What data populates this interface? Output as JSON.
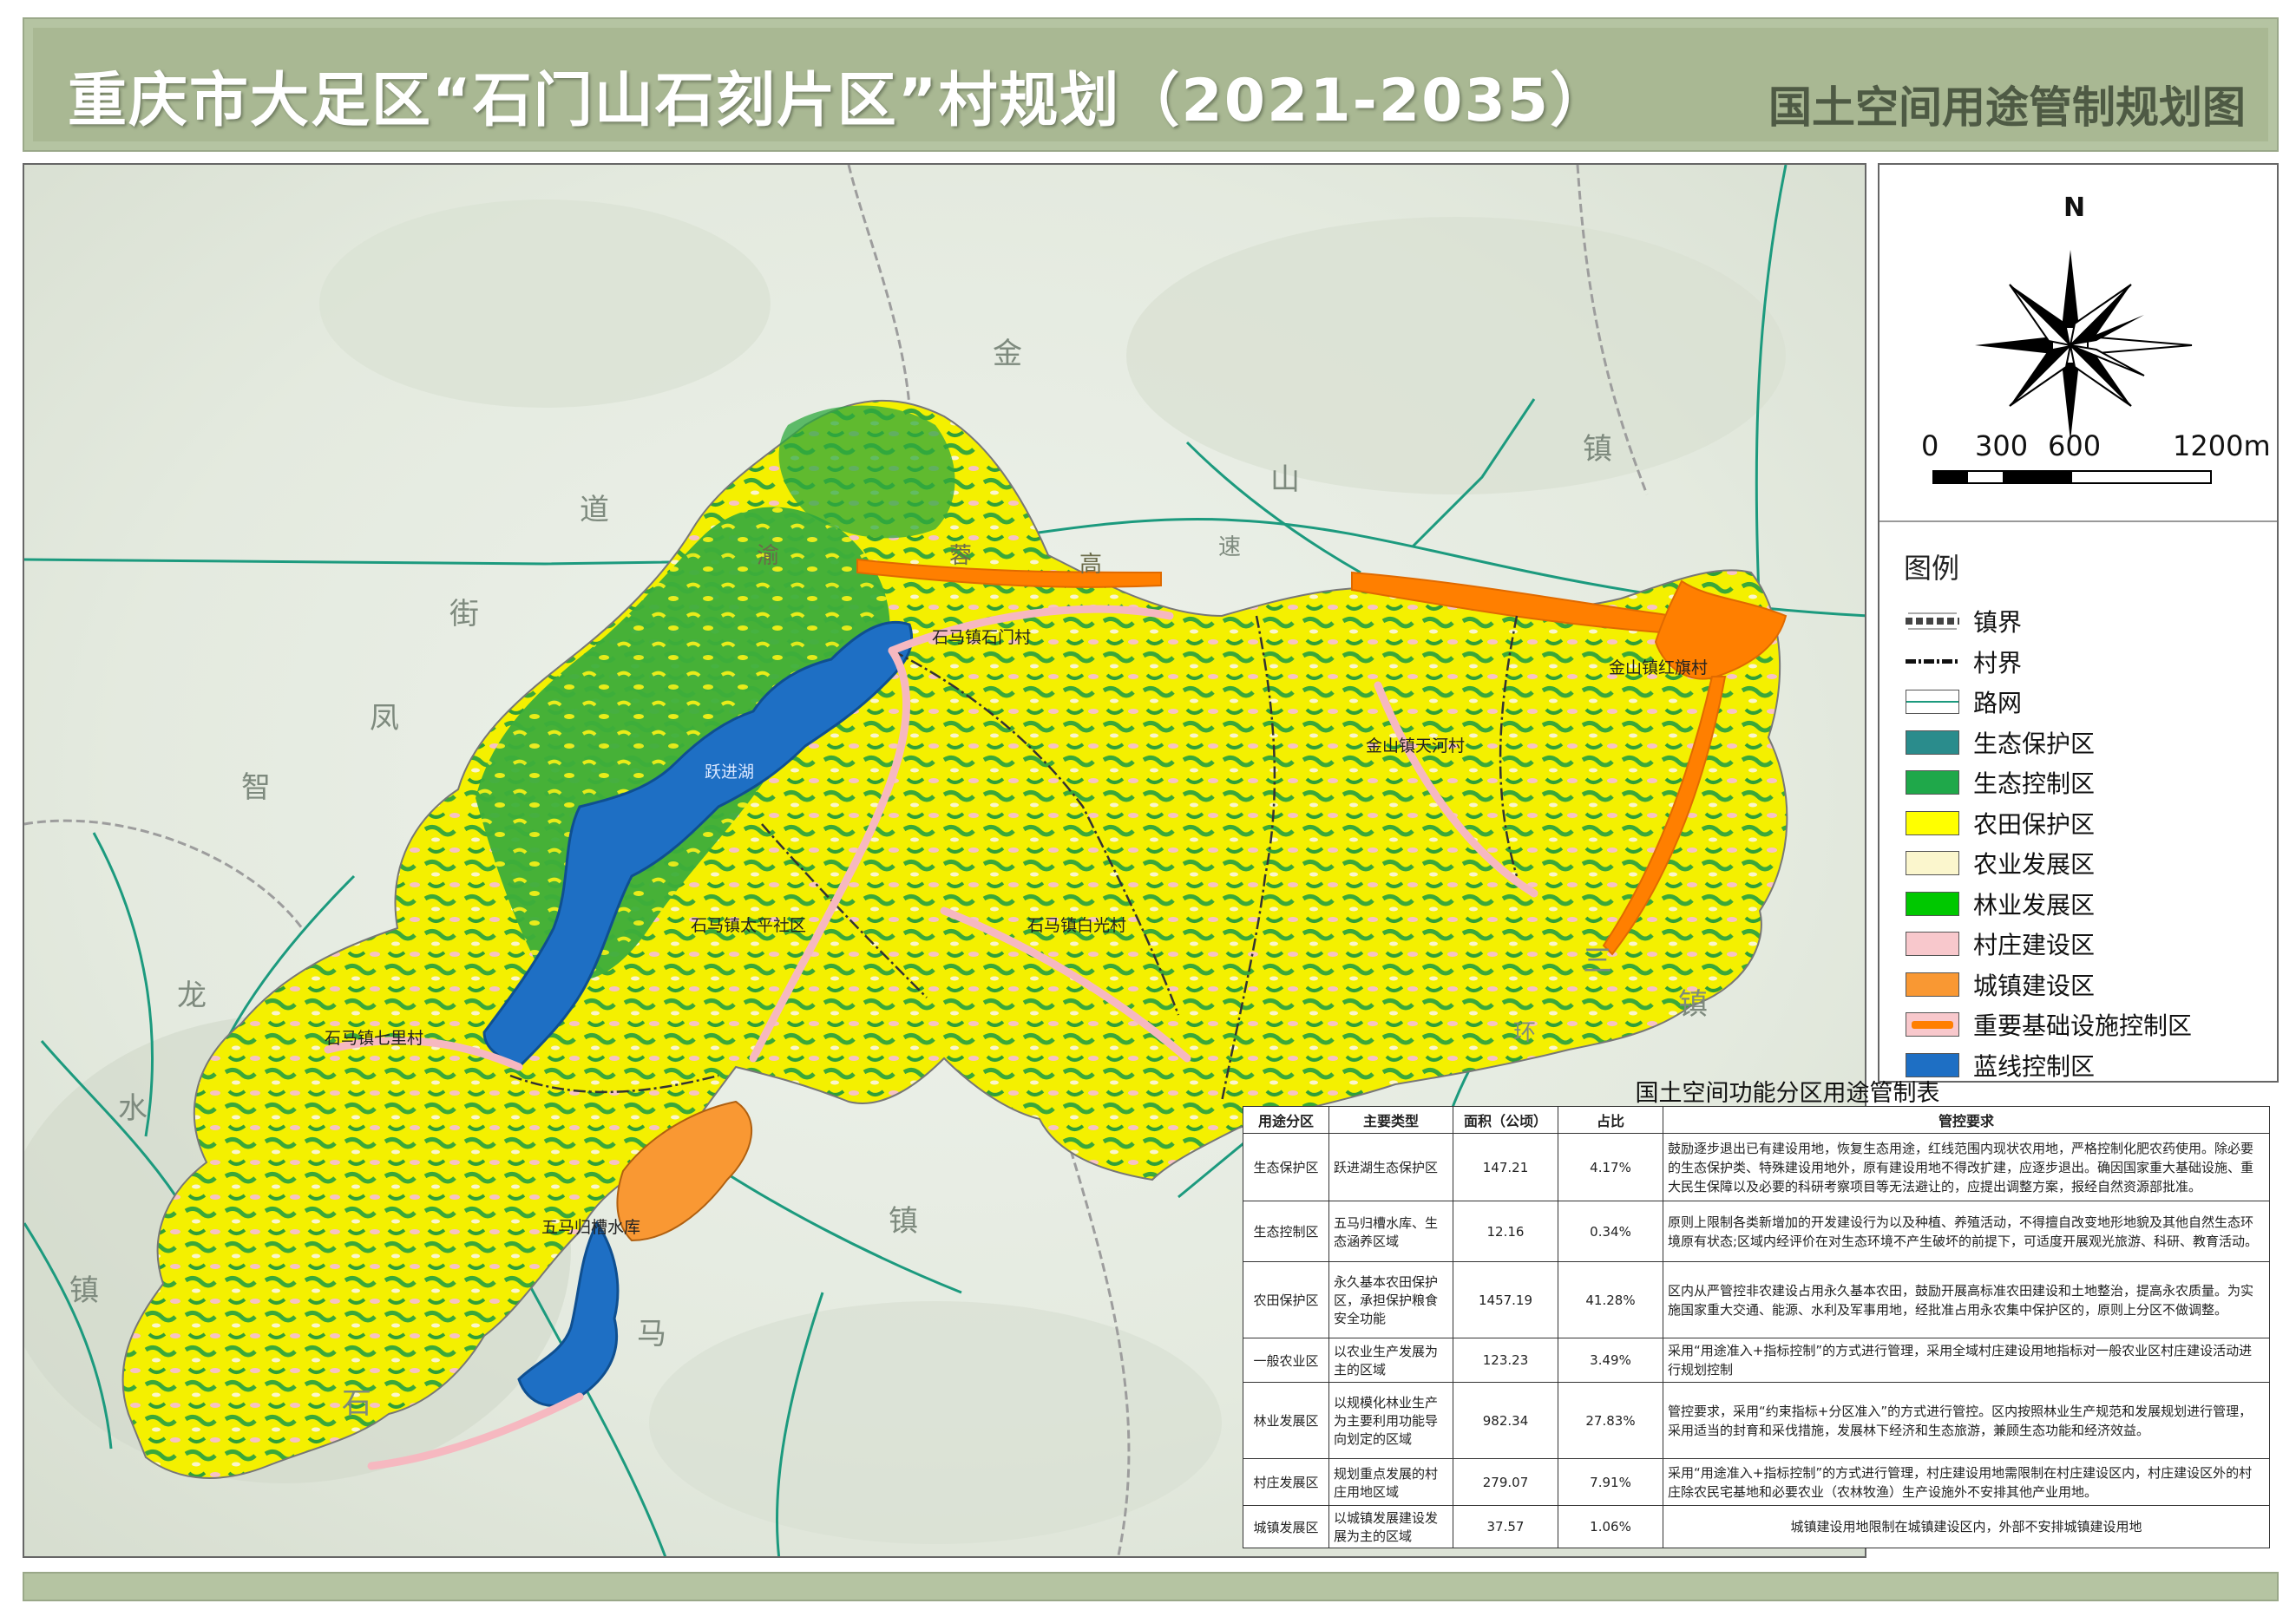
{
  "header": {
    "title": "重庆市大足区“石门山石刻片区”村规划（2021-2035）",
    "subtitle": "国土空间用途管制规划图"
  },
  "compass": {
    "north_label": "N"
  },
  "scale": {
    "labels": [
      "0",
      "300",
      "600",
      "1200m"
    ]
  },
  "legend": {
    "title": "图例",
    "items": [
      {
        "label": "镇界",
        "color": "#ffffff",
        "style": "town-line"
      },
      {
        "label": "村界",
        "color": "#ffffff",
        "style": "village-line"
      },
      {
        "label": "路网",
        "color": "#ffffff",
        "style": "road-line"
      },
      {
        "label": "生态保护区",
        "color": "#2a8c8c",
        "style": "fill"
      },
      {
        "label": "生态控制区",
        "color": "#1fa84a",
        "style": "fill"
      },
      {
        "label": "农田保护区",
        "color": "#ffff00",
        "style": "fill"
      },
      {
        "label": "农业发展区",
        "color": "#fbf6cd",
        "style": "fill"
      },
      {
        "label": "林业发展区",
        "color": "#00c800",
        "style": "fill"
      },
      {
        "label": "村庄建设区",
        "color": "#f8c8cc",
        "style": "fill"
      },
      {
        "label": "城镇建设区",
        "color": "#f99833",
        "style": "fill"
      },
      {
        "label": "重要基础设施控制区",
        "color": "#ff7f00",
        "style": "infra"
      },
      {
        "label": "蓝线控制区",
        "color": "#1e6fc4",
        "style": "fill"
      }
    ]
  },
  "map": {
    "place_labels": [
      "金",
      "山",
      "镇",
      "道",
      "街",
      "凤",
      "智",
      "龙",
      "水",
      "镇",
      "石",
      "马",
      "镇",
      "三",
      "镇",
      "环",
      "速",
      "高",
      "蓉",
      "渝"
    ],
    "village_labels": [
      "石马镇石门村",
      "金山镇红旗村",
      "金山镇天河村",
      "跃进湖",
      "石马镇太平社区",
      "石马镇白光村",
      "石马镇七里村",
      "五马归槽水库"
    ]
  },
  "table": {
    "title": "国土空间功能分区用途管制表",
    "headers": [
      "用途分区",
      "主要类型",
      "面积（公顷）",
      "占比",
      "管控要求"
    ],
    "rows": [
      [
        "生态保护区",
        "跃进湖生态保护区",
        "147.21",
        "4.17%",
        "鼓励逐步退出已有建设用地，恢复生态用途，红线范围内现状农用地，严格控制化肥农药使用。除必要的生态保护类、特殊建设用地外，原有建设用地不得改扩建，应逐步退出。确因国家重大基础设施、重大民生保障以及必要的科研考察项目等无法避让的，应提出调整方案，报经自然资源部批准。"
      ],
      [
        "生态控制区",
        "五马归槽水库、生态涵养区域",
        "12.16",
        "0.34%",
        "原则上限制各类新增加的开发建设行为以及种植、养殖活动，不得擅自改变地形地貌及其他自然生态环境原有状态;区域内经评价在对生态环境不产生破坏的前提下，可适度开展观光旅游、科研、教育活动。"
      ],
      [
        "农田保护区",
        "永久基本农田保护区，承担保护粮食安全功能",
        "1457.19",
        "41.28%",
        "区内从严管控非农建设占用永久基本农田，鼓励开展高标准农田建设和土地整治，提高永农质量。为实施国家重大交通、能源、水利及军事用地，经批准占用永农集中保护区的，原则上分区不做调整。"
      ],
      [
        "一般农业区",
        "以农业生产发展为主的区域",
        "123.23",
        "3.49%",
        "采用“用途准入+指标控制”的方式进行管理，采用全域村庄建设用地指标对一般农业区村庄建设活动进行规划控制"
      ],
      [
        "林业发展区",
        "以规模化林业生产为主要利用功能导向划定的区域",
        "982.34",
        "27.83%",
        "管控要求，采用“约束指标+分区准入”的方式进行管控。区内按照林业生产规范和发展规划进行管理，采用适当的封育和采伐措施，发展林下经济和生态旅游，兼顾生态功能和经济效益。"
      ],
      [
        "村庄发展区",
        "规划重点发展的村庄用地区域",
        "279.07",
        "7.91%",
        "采用“用途准入+指标控制”的方式进行管理，村庄建设用地需限制在村庄建设区内，村庄建设区外的村庄除农民宅基地和必要农业（农林牧渔）生产设施外不安排其他产业用地。"
      ],
      [
        "城镇发展区",
        "以城镇发展建设发展为主的区域",
        "37.57",
        "1.06%",
        "城镇建设用地限制在城镇建设区内，外部不安排城镇建设用地"
      ]
    ]
  }
}
